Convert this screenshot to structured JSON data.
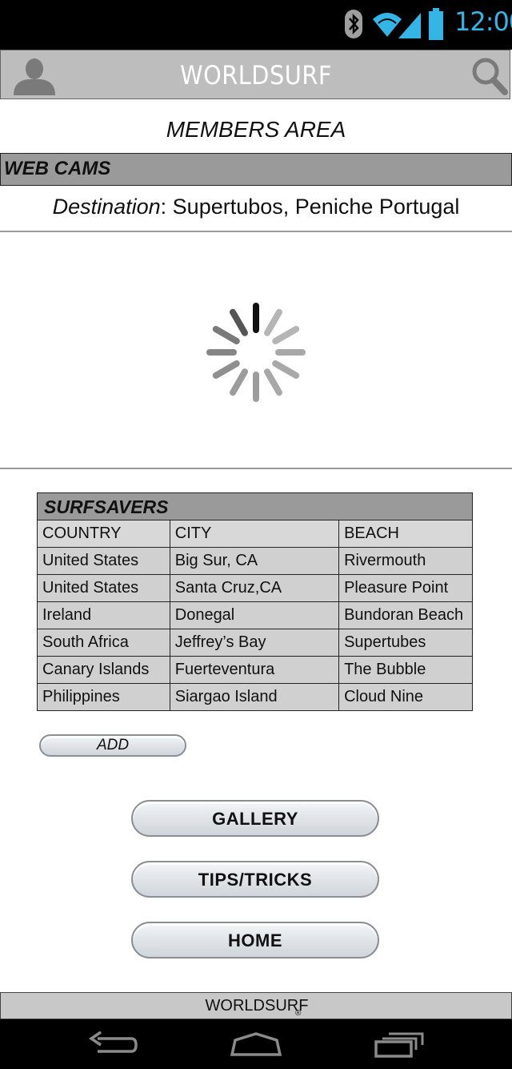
{
  "status_bar": {
    "time": "12:00",
    "icons": [
      "bluetooth-icon",
      "wifi-icon",
      "signal-icon",
      "battery-icon"
    ],
    "accent_color": "#33b5e5"
  },
  "app_bar": {
    "title": "WORLDSURF",
    "left_icon": "user-icon",
    "right_icon": "search-icon"
  },
  "page": {
    "subtitle": "MEMBERS AREA"
  },
  "webcams": {
    "section_title": "WEB CAMS",
    "destination_label": "Destination",
    "destination_value": ": Supertubos, Peniche Portugal",
    "loading_icon": "loading-spinner-icon"
  },
  "surfsavers": {
    "title": "SURFSAVERS",
    "columns": [
      "COUNTRY",
      "CITY",
      "BEACH"
    ],
    "rows": [
      [
        "United States",
        "Big Sur, CA",
        "Rivermouth"
      ],
      [
        "United States",
        "Santa Cruz,CA",
        "Pleasure Point"
      ],
      [
        "Ireland",
        "Donegal",
        "Bundoran Beach"
      ],
      [
        "South Africa",
        "Jeffrey’s Bay",
        "Supertubes"
      ],
      [
        "Canary Islands",
        "Fuerteventura",
        "The Bubble"
      ],
      [
        "Philippines",
        "Siargao Island",
        "Cloud Nine"
      ]
    ],
    "add_label": "ADD"
  },
  "buttons": {
    "gallery": "GALLERY",
    "tips": "TIPS/TRICKS",
    "home": "HOME"
  },
  "footer": {
    "brand": "WORLDSURF",
    "registered": "®"
  },
  "nav_bar": {
    "icons": [
      "back-icon",
      "home-icon",
      "recent-apps-icon"
    ]
  }
}
